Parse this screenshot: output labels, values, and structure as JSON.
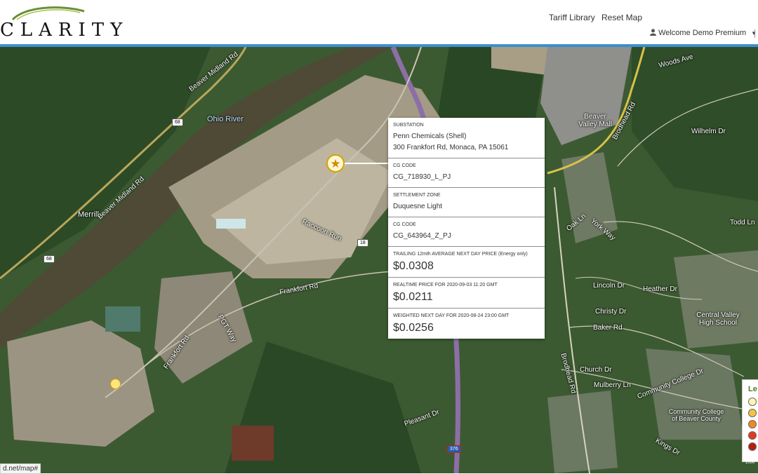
{
  "header": {
    "logo_text": "CLARITY",
    "nav": {
      "tariff_library": "Tariff Library",
      "reset_map": "Reset Map"
    },
    "user_menu": {
      "label": "Welcome Demo Premium"
    }
  },
  "map": {
    "labels": {
      "river": "Ohio River",
      "merrill": "Merrill",
      "beaver_midland_rd_1": "Beaver Midland Rd",
      "beaver_midland_rd_2": "Beaver Midland Rd",
      "frankfort_rd_1": "Frankfort Rd",
      "frankfort_rd_2": "Frankfort Rd",
      "pgt_way": "PGT Way",
      "raccoon_run": "Raccoon Run",
      "beaver_valley_mall": "Beaver Valley Mall",
      "brodhead_rd": "Brodhead Rd",
      "brodhead_rd_2": "Brodhead Rd",
      "heather_dr": "Heather Dr",
      "christy_dr": "Christy Dr",
      "baker_rd": "Baker Rd",
      "church_dr": "Church Dr",
      "mulberry_ln": "Mulberry Ln",
      "community_college_dr": "Community College Dr",
      "central_valley": "Central Valley High School",
      "ccbc": "Community College of Beaver County",
      "pleasant_dr": "Pleasant Dr",
      "lincoln_dr": "Lincoln Dr",
      "york_way": "York Way",
      "oak_ln": "Oak Ln",
      "woods_ave": "Woods Ave",
      "todd_ln": "Todd Ln",
      "kings_dr": "Kings Dr",
      "wilhelm_dr": "Wilhelm Dr"
    },
    "shields": {
      "route68_a": "68",
      "route68_b": "68",
      "route18": "18",
      "i376": "376"
    }
  },
  "popup": {
    "substation": {
      "label": "SUBSTATION",
      "name": "Penn Chemicals (Shell)",
      "address": "300 Frankfort Rd, Monaca, PA 15061"
    },
    "cg_code_1": {
      "label": "CG CODE",
      "value": "CG_718930_L_PJ"
    },
    "settlement_zone": {
      "label": "SETTLEMENT ZONE",
      "value": "Duquesne Light"
    },
    "cg_code_2": {
      "label": "CG CODE",
      "value": "CG_643964_Z_PJ"
    },
    "trailing_avg": {
      "label": "TRAILING 12mth AVERAGE NEXT DAY PRICE (Energy only)",
      "value": "$0.0308"
    },
    "realtime": {
      "label": "REALTIME PRICE FOR 2020-09-03 11:20 GMT",
      "value": "$0.0211"
    },
    "weighted": {
      "label": "WEIGHTED NEXT DAY FOR 2020-08-24 23:00 GMT",
      "value": "$0.0256"
    }
  },
  "legend": {
    "title": "Le",
    "colors": [
      "#fff6b3",
      "#f5c242",
      "#ee8a22",
      "#e23a1e",
      "#b3200f"
    ]
  },
  "status_url": "d.net/map#",
  "scale_text": "1000"
}
